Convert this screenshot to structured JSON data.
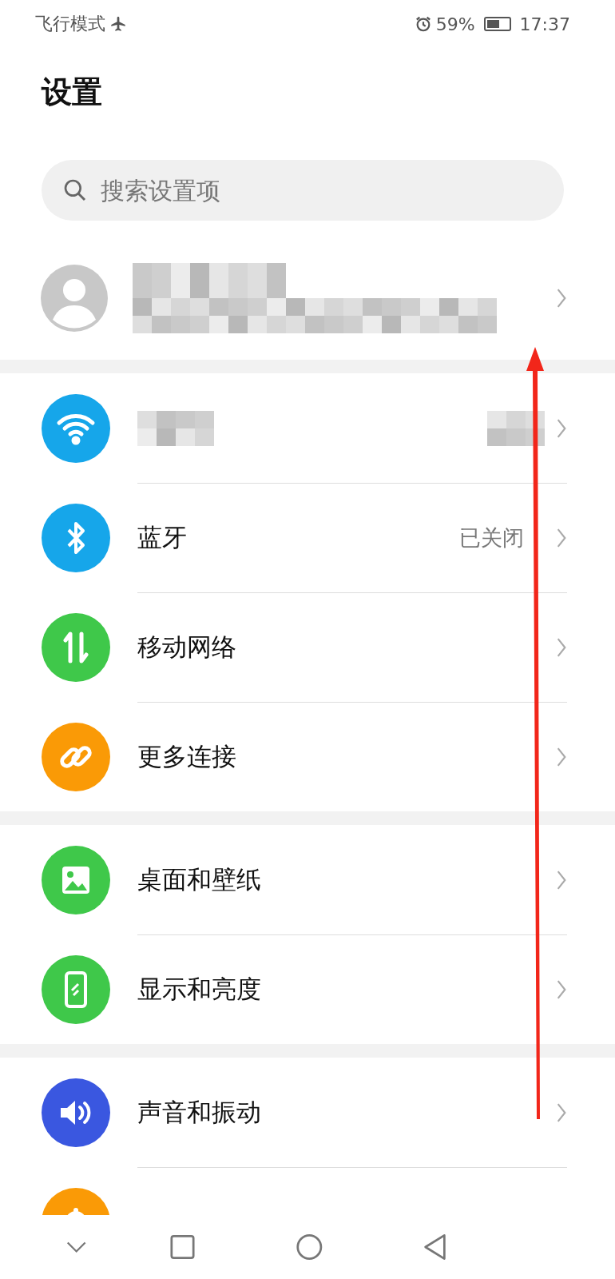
{
  "status_bar": {
    "mode_text": "飞行模式",
    "battery_text": "59%",
    "time": "17:37"
  },
  "title": "设置",
  "search": {
    "placeholder": "搜索设置项"
  },
  "profile": {
    "blurred": true
  },
  "groups": [
    {
      "items": [
        {
          "kind": "wifi",
          "color": "#16a6ea",
          "blurred": true
        },
        {
          "kind": "bluetooth",
          "color": "#16a6ea",
          "label": "蓝牙",
          "value": "已关闭"
        },
        {
          "kind": "updown",
          "color": "#3fc84a",
          "label": "移动网络"
        },
        {
          "kind": "link",
          "color": "#fa9a06",
          "label": "更多连接"
        }
      ]
    },
    {
      "items": [
        {
          "kind": "image",
          "color": "#3fc84a",
          "label": "桌面和壁纸"
        },
        {
          "kind": "phone",
          "color": "#3fc84a",
          "label": "显示和亮度"
        }
      ]
    },
    {
      "items": [
        {
          "kind": "speaker",
          "color": "#3a57e0",
          "label": "声音和振动"
        },
        {
          "kind": "bell",
          "color": "#fa9a06"
        }
      ]
    }
  ]
}
